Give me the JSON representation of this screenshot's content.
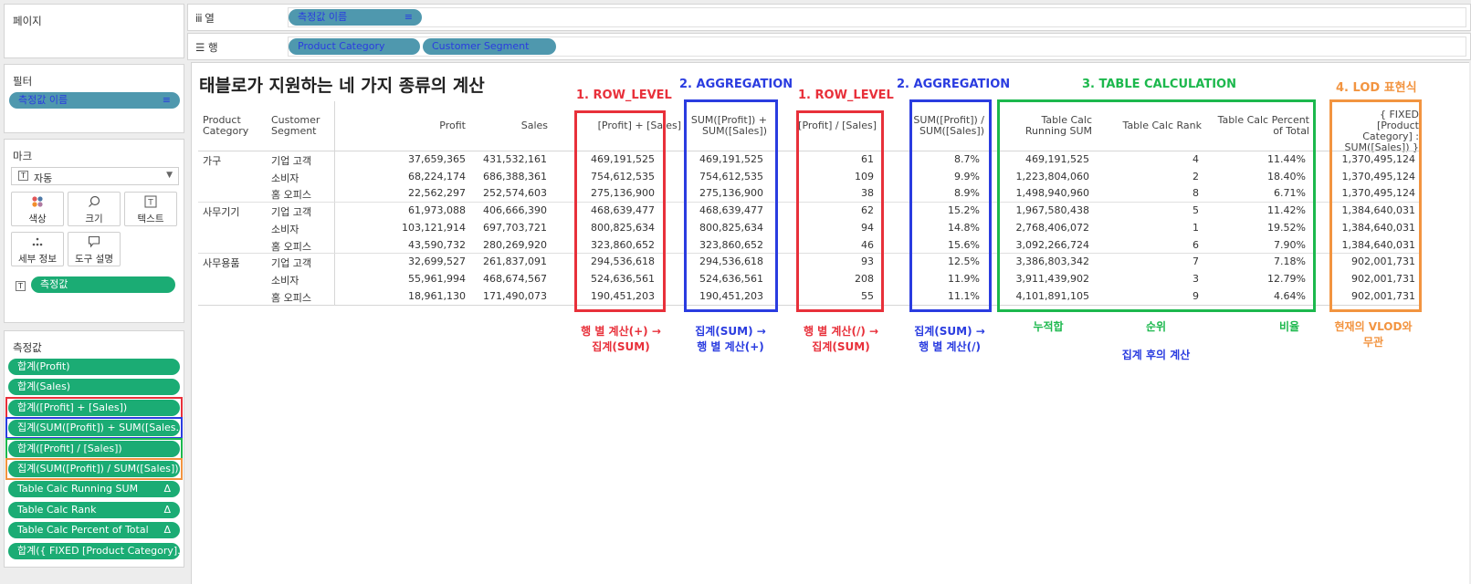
{
  "left": {
    "pages_title": "페이지",
    "filters_title": "필터",
    "filter_pill": "측정값 이름",
    "marks_title": "마크",
    "mark_type": "자동",
    "mark_buttons": [
      {
        "label": "색상",
        "icon": "color-icon"
      },
      {
        "label": "크기",
        "icon": "size-icon"
      },
      {
        "label": "텍스트",
        "icon": "text-icon"
      },
      {
        "label": "세부 정보",
        "icon": "detail-icon"
      },
      {
        "label": "도구 설명",
        "icon": "tooltip-icon"
      }
    ],
    "marks_pill": "측정값",
    "measures_title": "측정값",
    "measures": [
      "합계(Profit)",
      "합계(Sales)",
      "합계([Profit] + [Sales])",
      "집계(SUM([Profit]) + SUM([Sales..",
      "합계([Profit] / [Sales])",
      "집계(SUM([Profit]) / SUM([Sales]))",
      "Table Calc Running SUM",
      "Table Calc Rank",
      "Table Calc Percent of Total",
      "합계({ FIXED [Product Category].."
    ],
    "delta_symbol": "Δ"
  },
  "shelves": {
    "columns_label": "열",
    "columns_pill": "측정값 이름",
    "rows_label": "행",
    "rows_pills": [
      "Product Category",
      "Customer Segment"
    ]
  },
  "view": {
    "title": "태블로가 지원하는 네 가지 종류의 계산",
    "headers": {
      "product_category": "Product Category",
      "customer_segment": "Customer Segment",
      "profit": "Profit",
      "sales": "Sales",
      "row_sum": "[Profit] + [Sales]",
      "agg_sum": "SUM([Profit]) + SUM([Sales])",
      "row_div": "[Profit] / [Sales]",
      "agg_div": "SUM([Profit]) / SUM([Sales])",
      "running": "Table Calc Running SUM",
      "rank": "Table Calc Rank",
      "percent": "Table Calc Percent of Total",
      "lod": "{ FIXED [Product Category] : SUM([Sales]) }"
    },
    "categories": [
      "가구",
      "사무기기",
      "사무용품"
    ],
    "rows": [
      [
        "기업 고객",
        "37,659,365",
        "431,532,161",
        "469,191,525",
        "469,191,525",
        "61",
        "8.7%",
        "469,191,525",
        "4",
        "11.44%",
        "1,370,495,124"
      ],
      [
        "소비자",
        "68,224,174",
        "686,388,361",
        "754,612,535",
        "754,612,535",
        "109",
        "9.9%",
        "1,223,804,060",
        "2",
        "18.40%",
        "1,370,495,124"
      ],
      [
        "홈 오피스",
        "22,562,297",
        "252,574,603",
        "275,136,900",
        "275,136,900",
        "38",
        "8.9%",
        "1,498,940,960",
        "8",
        "6.71%",
        "1,370,495,124"
      ],
      [
        "기업 고객",
        "61,973,088",
        "406,666,390",
        "468,639,477",
        "468,639,477",
        "62",
        "15.2%",
        "1,967,580,438",
        "5",
        "11.42%",
        "1,384,640,031"
      ],
      [
        "소비자",
        "103,121,914",
        "697,703,721",
        "800,825,634",
        "800,825,634",
        "94",
        "14.8%",
        "2,768,406,072",
        "1",
        "19.52%",
        "1,384,640,031"
      ],
      [
        "홈 오피스",
        "43,590,732",
        "280,269,920",
        "323,860,652",
        "323,860,652",
        "46",
        "15.6%",
        "3,092,266,724",
        "6",
        "7.90%",
        "1,384,640,031"
      ],
      [
        "기업 고객",
        "32,699,527",
        "261,837,091",
        "294,536,618",
        "294,536,618",
        "93",
        "12.5%",
        "3,386,803,342",
        "7",
        "7.18%",
        "902,001,731"
      ],
      [
        "소비자",
        "55,961,994",
        "468,674,567",
        "524,636,561",
        "524,636,561",
        "208",
        "11.9%",
        "3,911,439,902",
        "3",
        "12.79%",
        "902,001,731"
      ],
      [
        "홈 오피스",
        "18,961,130",
        "171,490,073",
        "190,451,203",
        "190,451,203",
        "55",
        "11.1%",
        "4,101,891,105",
        "9",
        "4.64%",
        "902,001,731"
      ]
    ],
    "annotations": {
      "row_level_1": "1. ROW_LEVEL",
      "aggregation_1": "2. AGGREGATION",
      "row_level_2": "1. ROW_LEVEL",
      "aggregation_2": "2. AGGREGATION",
      "table_calc": "3. TABLE CALCULATION",
      "lod": "4. LOD 표현식",
      "note_row_sum": "행 별 계산(+) →\n집계(SUM)",
      "note_agg_sum": "집계(SUM) →\n행 별 계산(+)",
      "note_row_div": "행 별 계산(/) →\n집계(SUM)",
      "note_agg_div": "집계(SUM) →\n행 별 계산(/)",
      "note_running": "누적합",
      "note_rank": "순위",
      "note_percent": "비율",
      "note_after_agg": "집계 후의 계산",
      "note_lod": "현재의 VLOD와\n무관"
    }
  },
  "colors": {
    "pill_green": "#1bac74",
    "pill_blue": "#4f98ae",
    "red": "#e8303a",
    "blue": "#2a3ce0",
    "green": "#1cb84d",
    "orange": "#f29440"
  }
}
